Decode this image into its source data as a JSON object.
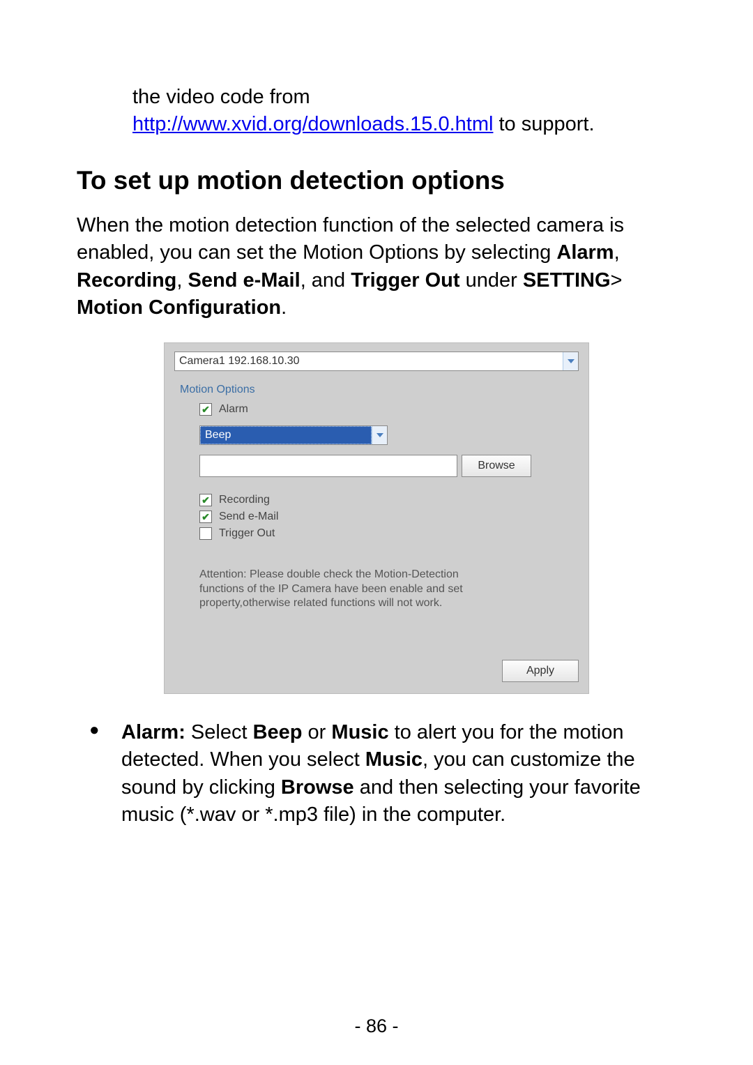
{
  "intro": {
    "before_link": "the video code from ",
    "link_text": "http://www.xvid.org/downloads.15.0.html",
    "after_link": " to support."
  },
  "heading": "To set up motion detection options",
  "para": {
    "t1": "When the motion detection function of the selected camera is enabled, you can set the Motion Options by selecting ",
    "b1": "Alarm",
    "t2": ", ",
    "b2": "Recording",
    "t3": ", ",
    "b3": "Send e-Mail",
    "t4": ", and ",
    "b4": "Trigger Out",
    "t5": " under ",
    "b5": "SETTING",
    "t6": "> ",
    "b6": "Motion Configuration",
    "t7": "."
  },
  "dialog": {
    "camera_select": "Camera1 192.168.10.30",
    "group_label": "Motion Options",
    "alarm_label": "Alarm",
    "alarm_mode": "Beep",
    "browse_btn": "Browse",
    "recording_label": "Recording",
    "sendmail_label": "Send e-Mail",
    "trigger_label": "Trigger Out",
    "attention": "Attention: Please double check the Motion-Detection functions of the IP Camera have been enable and set property,otherwise related functions will not work.",
    "apply_btn": "Apply",
    "checked": {
      "alarm": true,
      "recording": true,
      "sendmail": true,
      "trigger": false
    }
  },
  "bullet": {
    "b1": "Alarm:",
    "t1": "  Select ",
    "b2": "Beep",
    "t2": " or ",
    "b3": "Music",
    "t3": " to alert you for the motion detected.  When you select ",
    "b4": "Music",
    "t4": ", you can customize the sound by clicking ",
    "b5": "Browse",
    "t5": " and then selecting your favorite music (*.wav or *.mp3 file) in the computer."
  },
  "page_number": "- 86 -"
}
